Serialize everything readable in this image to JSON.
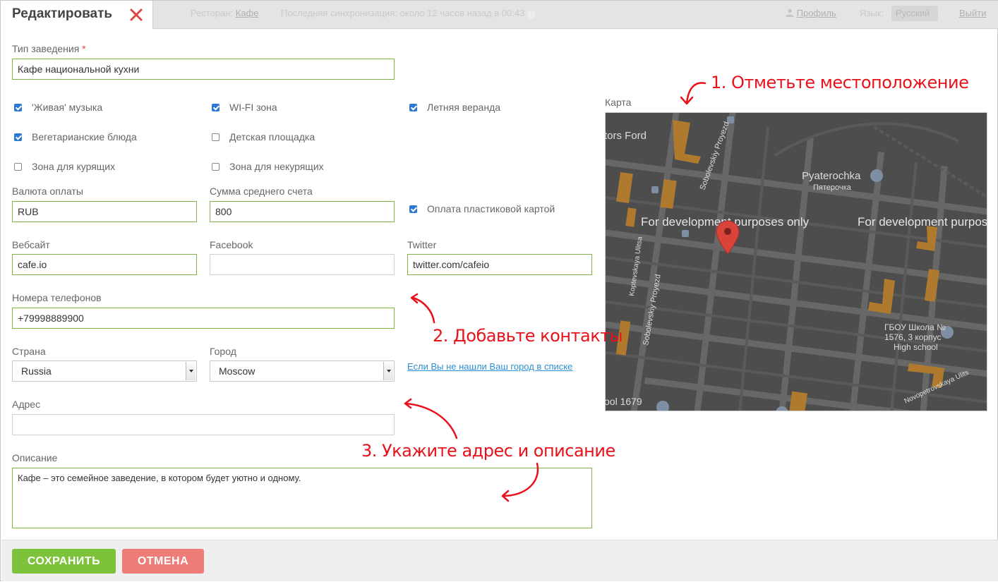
{
  "header": {
    "tab_title": "Редактировать",
    "restaurant_label": "Ресторан:",
    "restaurant_name": "Кафе",
    "sync_status": "Последняя синхронизация: около 12 часов назад в 00:43",
    "profile_label": "Профиль",
    "language_label": "Язык:",
    "language_value": "Русский",
    "logout_label": "Выйти"
  },
  "form": {
    "venue_type_label": "Тип заведения",
    "required_mark": "*",
    "venue_type_value": "Кафе национальной кухни",
    "amenities": [
      {
        "label": "'Живая' музыка",
        "checked": true
      },
      {
        "label": "WI-FI зона",
        "checked": true
      },
      {
        "label": "Летняя веранда",
        "checked": true
      },
      {
        "label": "Вегетарианские блюда",
        "checked": true
      },
      {
        "label": "Детская площадка",
        "checked": false
      },
      {
        "label": "Зона для курящих",
        "checked": false
      },
      {
        "label": "Зона для некурящих",
        "checked": false
      }
    ],
    "currency_label": "Валюта оплаты",
    "currency_value": "RUB",
    "avg_check_label": "Сумма среднего счета",
    "avg_check_value": "800",
    "card_payment_label": "Оплата пластиковой картой",
    "card_payment_checked": true,
    "website_label": "Вебсайт",
    "website_value": "cafe.io",
    "facebook_label": "Facebook",
    "facebook_value": "",
    "twitter_label": "Twitter",
    "twitter_value": "twitter.com/cafeio",
    "phones_label": "Номера телефонов",
    "phones_value": "+79998889900",
    "country_label": "Страна",
    "country_value": "Russia",
    "city_label": "Город",
    "city_value": "Moscow",
    "city_help_link": "Если Вы не нашли Ваш город в списке",
    "address_label": "Адрес",
    "address_value": "",
    "description_label": "Описание",
    "description_value": "Кафе – это семейное заведение, в котором будет уютно и одному."
  },
  "map": {
    "label": "Карта",
    "watermark": "For development purposes only",
    "place_labels": [
      "Pyaterochka",
      "Пятерочка",
      "ГБОУ Школа №",
      "1576, 3 корпус",
      "High school",
      "tors Ford",
      "Sobolevskiy Proyezd",
      "Koptevskaya Ulitsa",
      "Novopetrovskaya Ulits",
      "ool 1679"
    ],
    "colors": {
      "background": "#4d4d4d",
      "road": "#676767",
      "building": "#b07a2e",
      "pin": "#d9433a"
    }
  },
  "annotations": {
    "step1": "1. Отметьте местоположение",
    "step2": "2. Добавьте контакты",
    "step3": "3. Укажите адрес и описание",
    "color": "#e8121b"
  },
  "footer": {
    "save_label": "СОХРАНИТЬ",
    "cancel_label": "ОТМЕНА",
    "save_color": "#7cc23a",
    "cancel_color": "#ee7c78"
  }
}
